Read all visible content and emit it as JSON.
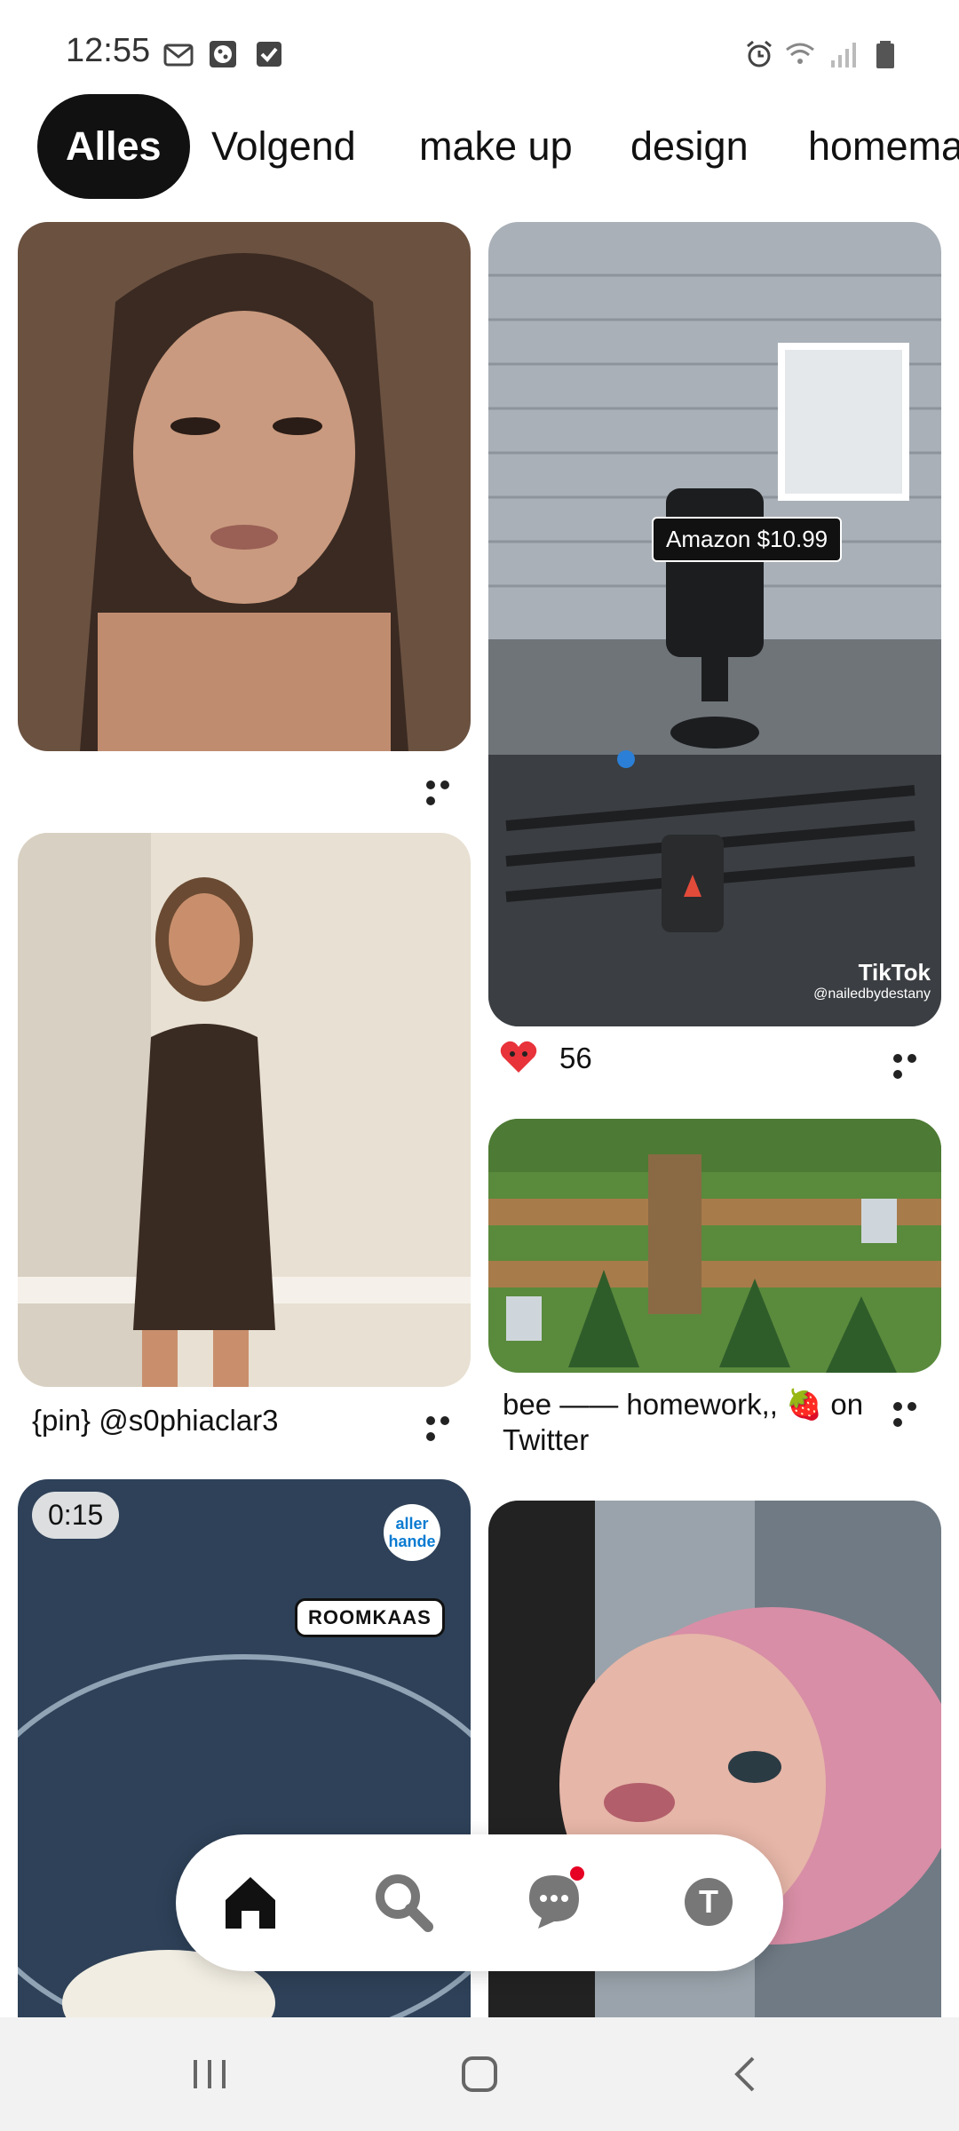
{
  "status_bar": {
    "time": "12:55",
    "icons": [
      "mail-icon",
      "cookie-icon",
      "check-icon",
      "alarm-icon",
      "wifi-icon",
      "signal-icon",
      "battery-icon"
    ]
  },
  "tabs": [
    "Alles",
    "Volgend",
    "make up",
    "design",
    "homemade"
  ],
  "active_tab": "Alles",
  "pins": [
    {
      "id": "portrait1",
      "caption": ""
    },
    {
      "id": "car-mount",
      "price_tag": "Amazon $10.99",
      "watermark": "TikTok",
      "watermark_user": "@nailedbydestany",
      "reaction_count": "56"
    },
    {
      "id": "dress",
      "caption": "{pin} @s0phiaclar3"
    },
    {
      "id": "game",
      "caption": "bee —— homework,, 🍓 on Twitter"
    },
    {
      "id": "video",
      "duration": "0:15",
      "badge_text": "aller hande",
      "label": "ROOMKAAS"
    },
    {
      "id": "pink-hair",
      "caption": ""
    }
  ],
  "bottom_nav": [
    "home-icon",
    "search-icon",
    "messages-icon",
    "profile-icon"
  ],
  "profile_initial": "T",
  "colors": {
    "accent": "#e60023",
    "active_tab_bg": "#111111",
    "heart": "#e8333a"
  }
}
